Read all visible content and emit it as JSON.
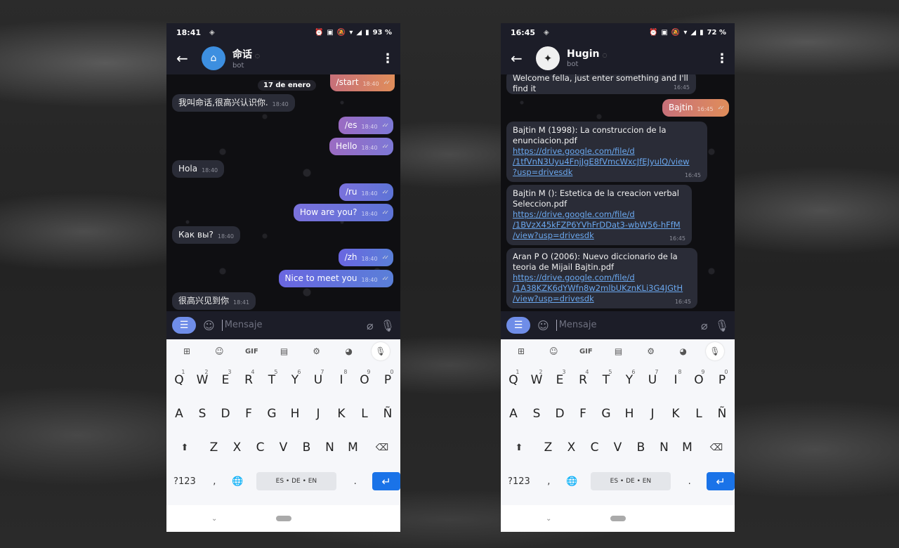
{
  "keyboard": {
    "row1": [
      {
        "k": "Q",
        "n": "1"
      },
      {
        "k": "W",
        "n": "2"
      },
      {
        "k": "E",
        "n": "3"
      },
      {
        "k": "R",
        "n": "4"
      },
      {
        "k": "T",
        "n": "5"
      },
      {
        "k": "Y",
        "n": "6"
      },
      {
        "k": "U",
        "n": "7"
      },
      {
        "k": "I",
        "n": "8"
      },
      {
        "k": "O",
        "n": "9"
      },
      {
        "k": "P",
        "n": "0"
      }
    ],
    "row2": [
      "A",
      "S",
      "D",
      "F",
      "G",
      "H",
      "J",
      "K",
      "L",
      "Ñ"
    ],
    "row3": [
      "Z",
      "X",
      "C",
      "V",
      "B",
      "N",
      "M"
    ],
    "toolbar": {
      "gif": "GIF"
    },
    "symbols": "?123",
    "space_label": "ES • DE • EN",
    "period": "."
  },
  "input": {
    "placeholder": "Mensaje"
  },
  "phone1": {
    "status": {
      "time": "18:41",
      "battery": "93 %"
    },
    "chat": {
      "title": "命话",
      "subtitle": "bot"
    },
    "date": "17 de enero",
    "messages": {
      "start": {
        "text": "/start",
        "time": "18:40"
      },
      "m1": {
        "text": "我叫命话,很高兴认识你.",
        "time": "18:40"
      },
      "es": {
        "text": "/es",
        "time": "18:40"
      },
      "hello": {
        "text": "Hello",
        "time": "18:40"
      },
      "hola": {
        "text": "Hola",
        "time": "18:40"
      },
      "ru": {
        "text": "/ru",
        "time": "18:40"
      },
      "how": {
        "text": "How are you?",
        "time": "18:40"
      },
      "kak": {
        "text": "Как вы?",
        "time": "18:40"
      },
      "zh": {
        "text": "/zh",
        "time": "18:40"
      },
      "nice": {
        "text": "Nice to meet you",
        "time": "18:40"
      },
      "zhreply": {
        "text": "很高兴见到你",
        "time": "18:41"
      }
    }
  },
  "phone2": {
    "status": {
      "time": "16:45",
      "battery": "72 %"
    },
    "chat": {
      "title": "Hugin",
      "subtitle": "bot"
    },
    "messages": {
      "welcome": {
        "line1": "Welcome fella, just enter something and I'll",
        "line2": "find it",
        "time": "16:45"
      },
      "bajtin": {
        "text": "Bajtin",
        "time": "16:45"
      },
      "doc1": {
        "title": "Bajtin M (1998): La construccion de la enunciacion.pdf",
        "l1": "https://drive.google.com/file/d",
        "l2": "/1tfVnN3Uyu4FnjJgE8fVmcWxcJfEJyulQ/view",
        "l3": "?usp=drivesdk",
        "time": "16:45"
      },
      "doc2": {
        "title": "Bajtin M (): Estetica de la creacion verbal Seleccion.pdf",
        "l1": "https://drive.google.com/file/d",
        "l2": "/1BVzX45kFZP6YVhFrDDat3-wbW56-hFfM",
        "l3": "/view?usp=drivesdk",
        "time": "16:45"
      },
      "doc3": {
        "title": "Aran P O (2006): Nuevo diccionario de la teoria de Mijail Bajtin.pdf",
        "l1": "https://drive.google.com/file/d",
        "l2": "/1A38KZK6dYWfn8w2mlbUKznKLi3G4JGtH",
        "l3": "/view?usp=drivesdk",
        "time": "16:45"
      }
    }
  }
}
